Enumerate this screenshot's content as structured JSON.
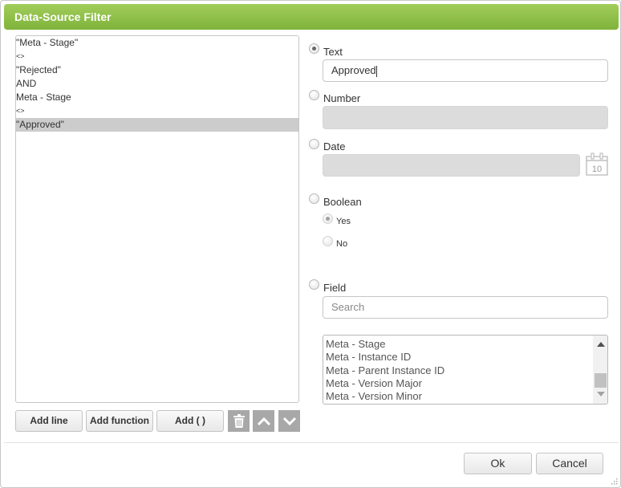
{
  "dialog": {
    "title": "Data-Source Filter"
  },
  "expression": {
    "lines": [
      {
        "text": "\"Meta - Stage\"",
        "selected": false,
        "small": false
      },
      {
        "text": "<>",
        "selected": false,
        "small": true
      },
      {
        "text": "\"Rejected\"",
        "selected": false,
        "small": false
      },
      {
        "text": "AND",
        "selected": false,
        "small": false
      },
      {
        "text": "Meta - Stage",
        "selected": false,
        "small": false
      },
      {
        "text": "<>",
        "selected": false,
        "small": true
      },
      {
        "text": "\"Approved\"",
        "selected": true,
        "small": false
      }
    ]
  },
  "toolbar": {
    "add_line": "Add line",
    "add_function": "Add function",
    "add_parens": "Add ( )",
    "delete_icon": "trash-icon",
    "up_icon": "chevron-up-icon",
    "down_icon": "chevron-down-icon"
  },
  "value_types": {
    "selected": "text",
    "text": {
      "label": "Text",
      "value": "Approved"
    },
    "number": {
      "label": "Number",
      "value": ""
    },
    "date": {
      "label": "Date",
      "value": "",
      "calendar_icon_text": "10"
    },
    "boolean": {
      "label": "Boolean",
      "yes_label": "Yes",
      "no_label": "No",
      "selected_option": "yes"
    },
    "field": {
      "label": "Field",
      "search_placeholder": "Search",
      "options": [
        "Meta - Stage",
        "Meta - Instance ID",
        "Meta - Parent Instance ID",
        "Meta - Version Major",
        "Meta - Version Minor"
      ]
    }
  },
  "footer": {
    "ok": "Ok",
    "cancel": "Cancel"
  },
  "colors": {
    "title_bar_top": "#a2cd5a",
    "title_bar_bottom": "#7fb33b",
    "selected_row": "#cccccc",
    "icon_button": "#a8a8a8"
  }
}
